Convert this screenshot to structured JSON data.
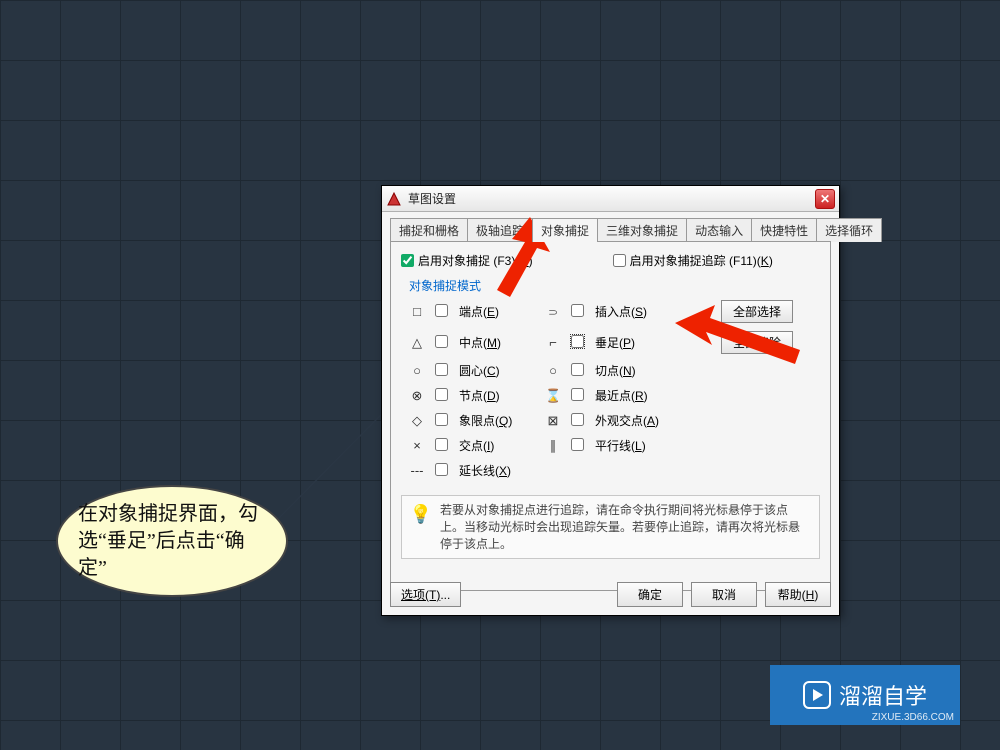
{
  "dialog": {
    "title": "草图设置",
    "tabs": {
      "snap_grid": "捕捉和栅格",
      "polar": "极轴追踪",
      "osnap": "对象捕捉",
      "osnap3d": "三维对象捕捉",
      "dyn_input": "动态输入",
      "quick_props": "快捷特性",
      "cycle": "选择循环"
    },
    "main": {
      "enable_osnap": "启用对象捕捉 (F3)(",
      "enable_osnap_k": "O",
      "close_paren": ")",
      "enable_track": "启用对象捕捉追踪 (F11)(",
      "enable_track_k": "K",
      "group_label": "对象捕捉模式",
      "btn_all": "全部选择",
      "btn_clear": "全部清除",
      "modes_left": [
        {
          "sym": "□",
          "label": "端点(",
          "k": "E"
        },
        {
          "sym": "△",
          "label": "中点(",
          "k": "M"
        },
        {
          "sym": "○",
          "label": "圆心(",
          "k": "C"
        },
        {
          "sym": "⊗",
          "label": "节点(",
          "k": "D"
        },
        {
          "sym": "◇",
          "label": "象限点(",
          "k": "Q"
        },
        {
          "sym": "×",
          "label": "交点(",
          "k": "I"
        },
        {
          "sym": "---",
          "label": "延长线(",
          "k": "X"
        }
      ],
      "modes_right": [
        {
          "sym": "⸧",
          "label": "插入点(",
          "k": "S"
        },
        {
          "sym": "⌐",
          "label": "垂足(",
          "k": "P"
        },
        {
          "sym": "○",
          "label": "切点(",
          "k": "N"
        },
        {
          "sym": "⌛",
          "label": "最近点(",
          "k": "R"
        },
        {
          "sym": "⊠",
          "label": "外观交点(",
          "k": "A"
        },
        {
          "sym": "∥",
          "label": "平行线(",
          "k": "L"
        }
      ],
      "hint": "若要从对象捕捉点进行追踪，请在命令执行期间将光标悬停于该点上。当移动光标时会出现追踪矢量。若要停止追踪，请再次将光标悬停于该点上。"
    },
    "buttons": {
      "options": "选项(T)...",
      "ok": "确定",
      "cancel": "取消",
      "help_pre": "帮助(",
      "help_k": "H",
      "help_post": ")"
    }
  },
  "annotation": {
    "text": "在对象捕捉界面，勾选“垂足”后点击“确定”"
  },
  "badge": {
    "name": "溜溜自学",
    "url": "ZIXUE.3D66.COM"
  }
}
